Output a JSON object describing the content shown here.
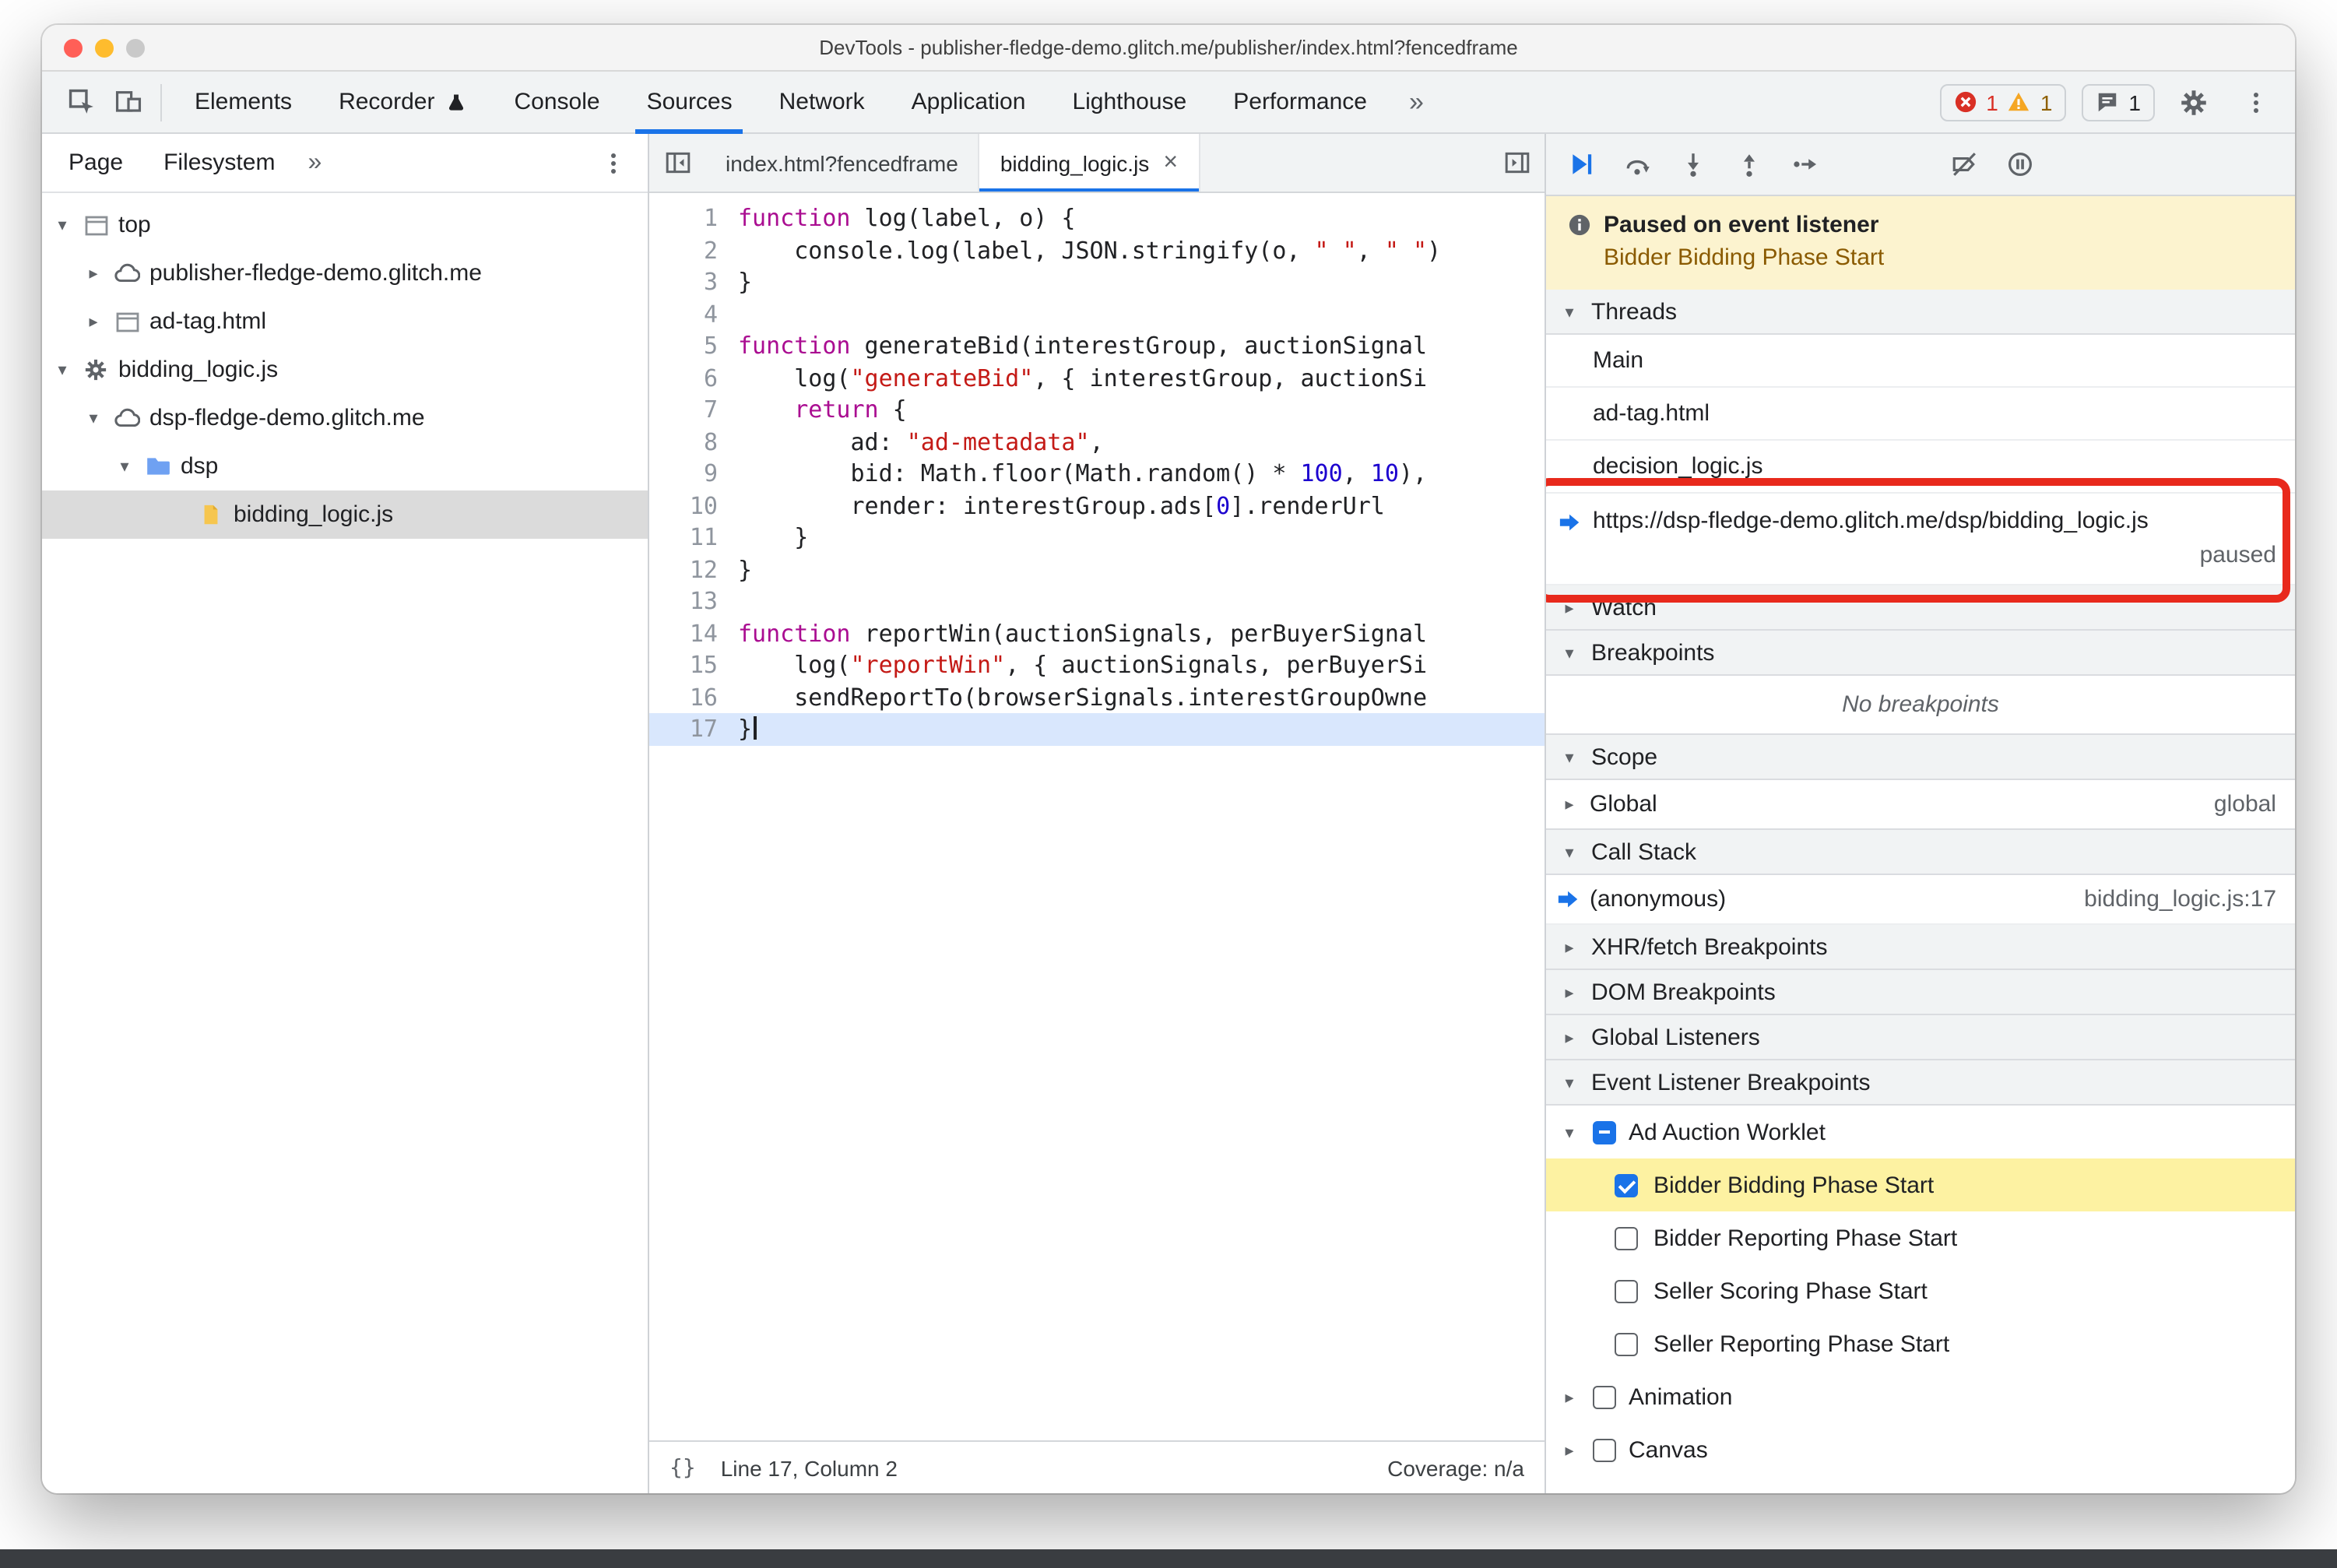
{
  "window": {
    "title": "DevTools - publisher-fledge-demo.glitch.me/publisher/index.html?fencedframe"
  },
  "colors": {
    "accent": "#1a73e8",
    "error": "#d93025",
    "warning": "#f5a623",
    "annotation_red": "#e8291c",
    "paused_banner_bg": "#fcf3cf",
    "breakpoint_highlight": "#fdf2a2",
    "current_line": "#d9e7fd"
  },
  "icons": {
    "chevron_down": "▾",
    "chevron_right": "▸",
    "more": "»",
    "brackets": "{}"
  },
  "toolbar": {
    "tabs": [
      {
        "label": "Elements"
      },
      {
        "label": "Recorder"
      },
      {
        "label": "Console"
      },
      {
        "label": "Sources"
      },
      {
        "label": "Network"
      },
      {
        "label": "Application"
      },
      {
        "label": "Lighthouse"
      },
      {
        "label": "Performance"
      }
    ],
    "errors": "1",
    "warnings": "1",
    "issues": "1"
  },
  "sidebar": {
    "tabs": [
      {
        "label": "Page"
      },
      {
        "label": "Filesystem"
      }
    ],
    "tree": [
      {
        "label": "top"
      },
      {
        "label": "publisher-fledge-demo.glitch.me"
      },
      {
        "label": "ad-tag.html"
      },
      {
        "label": "bidding_logic.js"
      },
      {
        "label": "dsp-fledge-demo.glitch.me"
      },
      {
        "label": "dsp"
      },
      {
        "label": "bidding_logic.js"
      }
    ]
  },
  "editor": {
    "tabs": [
      {
        "label": "index.html?fencedframe"
      },
      {
        "label": "bidding_logic.js",
        "close": "×"
      }
    ],
    "current_line": 17,
    "lines": [
      {
        "n": 1,
        "seg": [
          [
            "k",
            "function"
          ],
          [
            "p",
            " log(label, o) {"
          ]
        ]
      },
      {
        "n": 2,
        "seg": [
          [
            "p",
            "    console.log(label, JSON.stringify(o, "
          ],
          [
            "s",
            "\" \""
          ],
          [
            "p",
            ", "
          ],
          [
            "s",
            "\" \""
          ],
          [
            "p",
            ")"
          ]
        ]
      },
      {
        "n": 3,
        "seg": [
          [
            "p",
            "}"
          ]
        ]
      },
      {
        "n": 4,
        "seg": []
      },
      {
        "n": 5,
        "seg": [
          [
            "k",
            "function"
          ],
          [
            "p",
            " generateBid(interestGroup, auctionSignal"
          ]
        ]
      },
      {
        "n": 6,
        "seg": [
          [
            "p",
            "    log("
          ],
          [
            "s",
            "\"generateBid\""
          ],
          [
            "p",
            ", { interestGroup, auctionSi"
          ]
        ]
      },
      {
        "n": 7,
        "seg": [
          [
            "p",
            "    "
          ],
          [
            "k",
            "return"
          ],
          [
            "p",
            " {"
          ]
        ]
      },
      {
        "n": 8,
        "seg": [
          [
            "p",
            "        ad: "
          ],
          [
            "s",
            "\"ad-metadata\""
          ],
          [
            "p",
            ","
          ]
        ]
      },
      {
        "n": 9,
        "seg": [
          [
            "p",
            "        bid: Math.floor(Math.random() * "
          ],
          [
            "n",
            "100"
          ],
          [
            "p",
            ", "
          ],
          [
            "n",
            "10"
          ],
          [
            "p",
            "),"
          ]
        ]
      },
      {
        "n": 10,
        "seg": [
          [
            "p",
            "        render: interestGroup.ads["
          ],
          [
            "n",
            "0"
          ],
          [
            "p",
            "].renderUrl"
          ]
        ]
      },
      {
        "n": 11,
        "seg": [
          [
            "p",
            "    }"
          ]
        ]
      },
      {
        "n": 12,
        "seg": [
          [
            "p",
            "}"
          ]
        ]
      },
      {
        "n": 13,
        "seg": []
      },
      {
        "n": 14,
        "seg": [
          [
            "k",
            "function"
          ],
          [
            "p",
            " reportWin(auctionSignals, perBuyerSignal"
          ]
        ]
      },
      {
        "n": 15,
        "seg": [
          [
            "p",
            "    log("
          ],
          [
            "s",
            "\"reportWin\""
          ],
          [
            "p",
            ", { auctionSignals, perBuyerSi"
          ]
        ]
      },
      {
        "n": 16,
        "seg": [
          [
            "p",
            "    sendReportTo(browserSignals.interestGroupOwne"
          ]
        ]
      },
      {
        "n": 17,
        "seg": [
          [
            "p",
            "}"
          ]
        ]
      }
    ],
    "status": {
      "line_col": "Line 17, Column 2",
      "coverage": "Coverage: n/a"
    }
  },
  "debugger": {
    "paused": {
      "title": "Paused on event listener",
      "reason": "Bidder Bidding Phase Start"
    },
    "threads": {
      "title": "Threads",
      "items": [
        {
          "label": "Main"
        },
        {
          "label": "ad-tag.html"
        },
        {
          "label": "decision_logic.js"
        },
        {
          "label": "https://dsp-fledge-demo.glitch.me/dsp/bidding_logic.js",
          "status": "paused"
        }
      ]
    },
    "watch": {
      "title": "Watch"
    },
    "breakpoints": {
      "title": "Breakpoints",
      "empty": "No breakpoints"
    },
    "scope": {
      "title": "Scope",
      "items": [
        {
          "label": "Global",
          "value": "global"
        }
      ]
    },
    "call_stack": {
      "title": "Call Stack",
      "items": [
        {
          "label": "(anonymous)",
          "location": "bidding_logic.js:17"
        }
      ]
    },
    "collapsed_sections": [
      "XHR/fetch Breakpoints",
      "DOM Breakpoints",
      "Global Listeners"
    ],
    "event_listener_breakpoints": {
      "title": "Event Listener Breakpoints",
      "groups": [
        {
          "label": "Ad Auction Worklet",
          "items": [
            {
              "label": "Bidder Bidding Phase Start"
            },
            {
              "label": "Bidder Reporting Phase Start"
            },
            {
              "label": "Seller Scoring Phase Start"
            },
            {
              "label": "Seller Reporting Phase Start"
            }
          ]
        },
        {
          "label": "Animation"
        },
        {
          "label": "Canvas"
        }
      ]
    }
  }
}
